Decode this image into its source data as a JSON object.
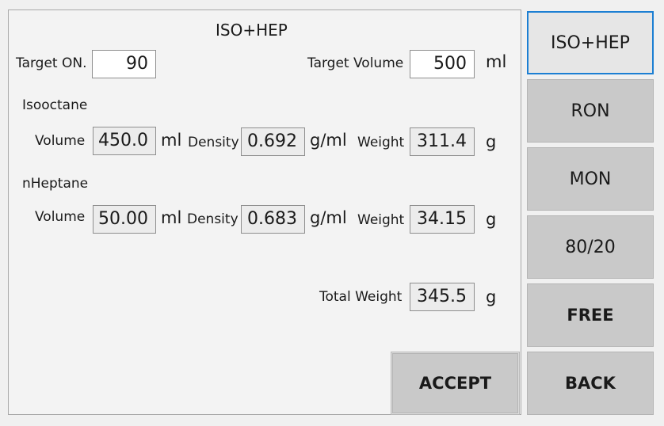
{
  "title": "ISO+HEP",
  "target_on": {
    "label": "Target ON.",
    "value": "90"
  },
  "target_volume": {
    "label": "Target Volume",
    "value": "500",
    "unit": "ml"
  },
  "isooctane": {
    "heading": "Isooctane",
    "volume_label": "Volume",
    "volume": "450.0",
    "volume_unit": "ml",
    "density_label": "Density",
    "density": "0.692",
    "density_unit": "g/ml",
    "weight_label": "Weight",
    "weight": "311.4",
    "weight_unit": "g"
  },
  "nheptane": {
    "heading": "nHeptane",
    "volume_label": "Volume",
    "volume": "50.00",
    "volume_unit": "ml",
    "density_label": "Density",
    "density": "0.683",
    "density_unit": "g/ml",
    "weight_label": "Weight",
    "weight": "34.15",
    "weight_unit": "g"
  },
  "total": {
    "label": "Total Weight",
    "value": "345.5",
    "unit": "g"
  },
  "accept_label": "ACCEPT",
  "sidebar": {
    "buttons": [
      {
        "label": "ISO+HEP",
        "selected": true
      },
      {
        "label": "RON"
      },
      {
        "label": "MON"
      },
      {
        "label": "80/20"
      },
      {
        "label": "FREE"
      },
      {
        "label": "BACK"
      }
    ]
  },
  "colors": {
    "accent": "#1c7fd3",
    "button": "#c9c9c9",
    "panel": "#f3f3f3"
  }
}
